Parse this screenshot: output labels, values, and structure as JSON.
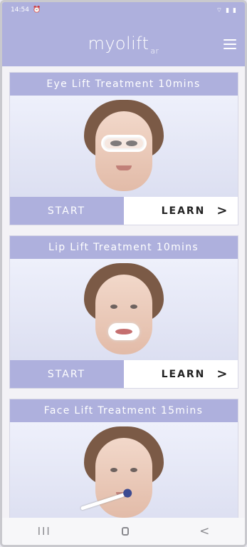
{
  "status": {
    "time": "14:54",
    "left_icon": "alarm-icon",
    "right_icons": [
      "wifi-icon",
      "signal-icon",
      "battery-icon"
    ]
  },
  "app": {
    "logo_main": "myolift",
    "logo_sub": "ar",
    "menu_icon": "hamburger-menu-icon"
  },
  "cards": [
    {
      "title": "Eye Lift Treatment 10mins",
      "start": "START",
      "learn": "LEARN",
      "chevron": ">",
      "image": "eye-mask-face"
    },
    {
      "title": "Lip Lift Treatment 10mins",
      "start": "START",
      "learn": "LEARN",
      "chevron": ">",
      "image": "lip-mask-face"
    },
    {
      "title": "Face Lift Treatment 15mins",
      "image": "face-device-face"
    }
  ],
  "nav": {
    "recent": "III",
    "home": "home-icon",
    "back": "<"
  }
}
